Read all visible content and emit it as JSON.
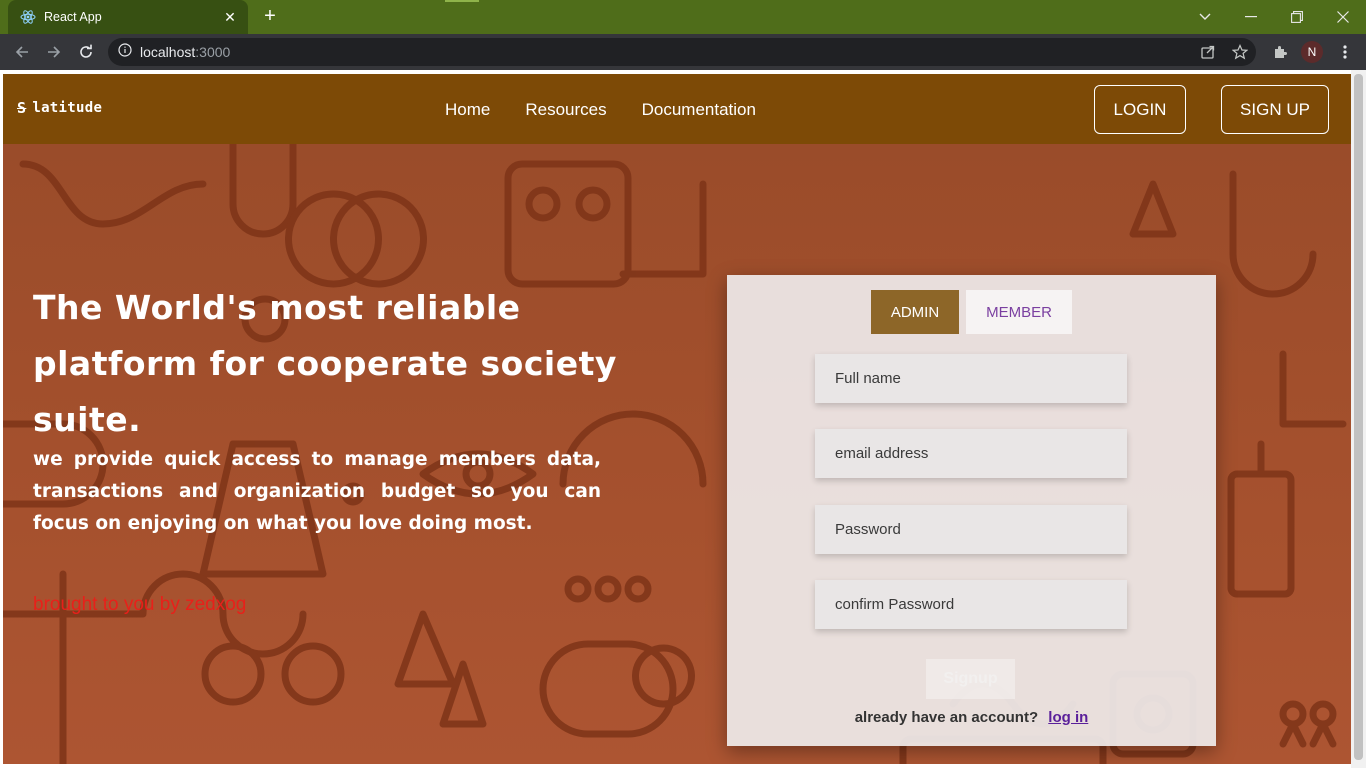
{
  "browser": {
    "tab_title": "React App",
    "tab_close": "✕",
    "new_tab": "+",
    "url_host": "localhost",
    "url_port": ":3000",
    "profile_initial": "N"
  },
  "header": {
    "logo_mark": "S",
    "logo_text": "latitude",
    "nav": [
      "Home",
      "Resources",
      "Documentation"
    ],
    "login_label": "LOGIN",
    "signup_label": "SIGN UP"
  },
  "hero": {
    "headline": "The World's most reliable platform for cooperate society suite.",
    "subtext": "we provide quick access to manage members data, transactions and organization budget so you can focus on enjoying on what you love doing most.",
    "credit": "brought to you by zedxog"
  },
  "form": {
    "tabs": {
      "admin": "ADMIN",
      "member": "MEMBER"
    },
    "active_tab": "ADMIN",
    "fields": {
      "full_name": "Full name",
      "email": "email address",
      "password": "Password",
      "confirm_password": "confirm Password"
    },
    "submit_label": "Signup",
    "already_text": "already have an account?",
    "login_link": "log in"
  },
  "colors": {
    "tabbar": "#4f6d1a",
    "header": "#7d4a06",
    "hero": "#a4502d",
    "admin_tab": "#8d6628",
    "member_text": "#7a3fa0",
    "credit": "#e8201a"
  }
}
